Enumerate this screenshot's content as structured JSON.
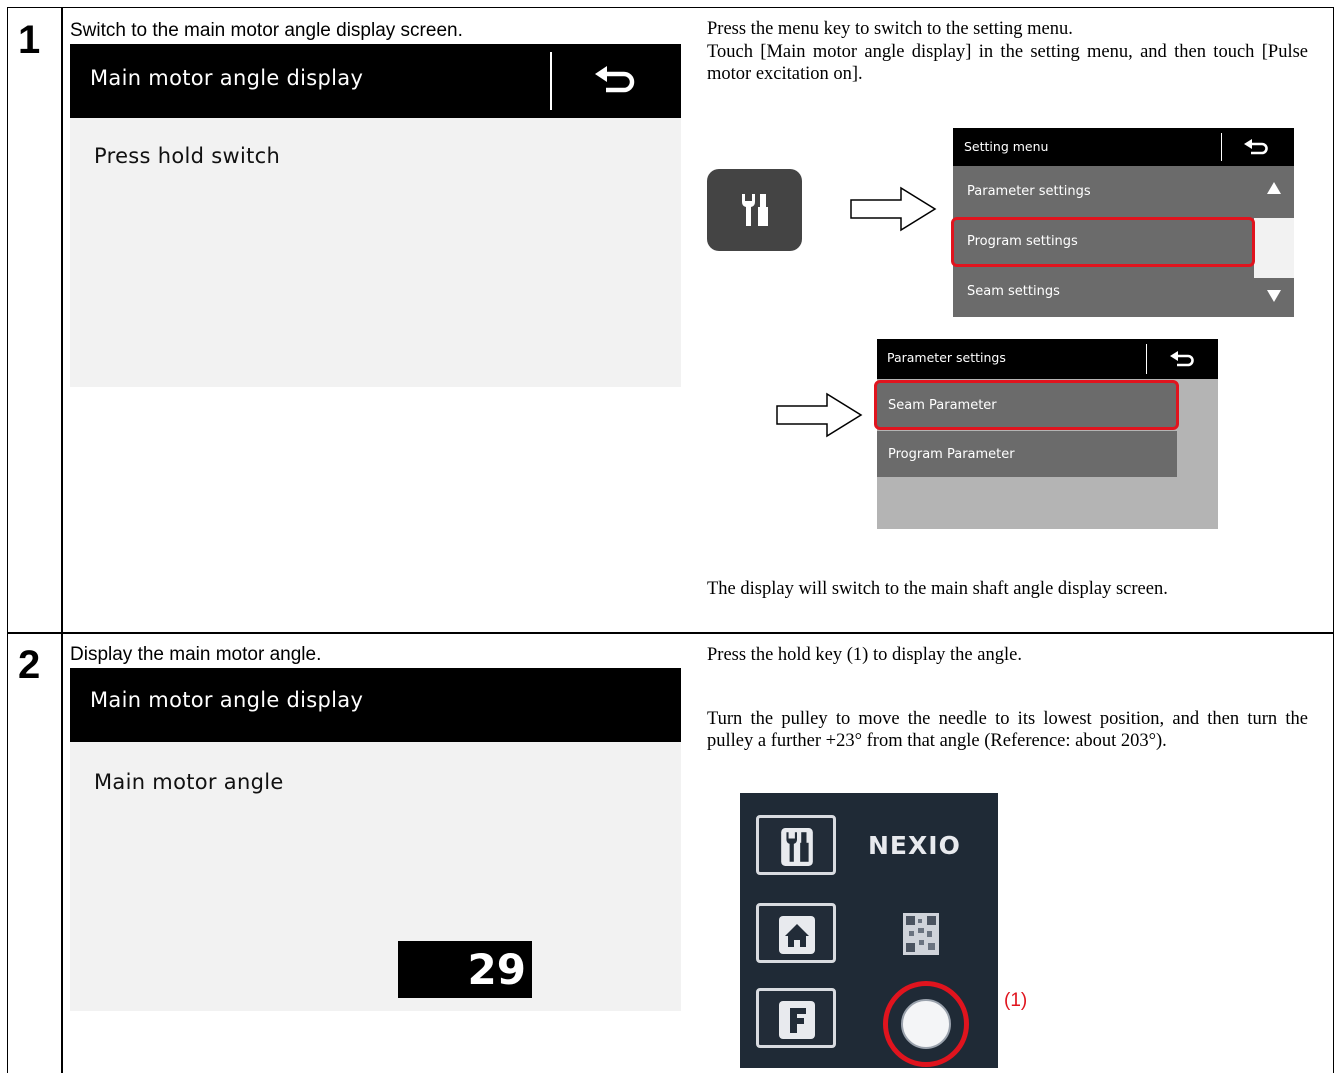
{
  "steps": [
    {
      "number": "1",
      "caption": "Switch to the main motor angle display screen.",
      "screen": {
        "title": "Main motor angle display",
        "body_text": "Press hold switch"
      },
      "instructions": {
        "line1": "Press the menu key to switch to the setting menu.",
        "line2": "Touch [Main motor angle display] in the setting menu, and then touch [Pulse motor excitation on].",
        "result": "The display will switch to the main shaft angle display screen."
      },
      "setting_menu": {
        "title": "Setting menu",
        "items": [
          "Parameter settings",
          "Program settings",
          "Seam settings"
        ],
        "highlighted": "Program settings"
      },
      "parameter_menu": {
        "title": "Parameter settings",
        "items": [
          "Seam Parameter",
          "Program Parameter"
        ],
        "highlighted": "Seam Parameter"
      }
    },
    {
      "number": "2",
      "caption": "Display the main motor angle.",
      "screen": {
        "title": "Main motor angle display",
        "label": "Main motor angle",
        "angle_value": "29"
      },
      "instructions": {
        "line1": "Press the hold key (1) to display the angle.",
        "line2": "Turn the pulley to move the needle to its lowest position, and then turn the pulley a further +23° from that angle (Reference: about 203°)."
      },
      "control_panel": {
        "brand": "NEXIO",
        "hold_key_label": "(1)",
        "buttons": [
          "menu-key",
          "home-key",
          "F"
        ]
      }
    }
  ],
  "colors": {
    "highlight": "#e0141e",
    "menu_row": "#6b6b6b",
    "panel_bg": "#f2f2f2",
    "control_panel_bg": "#1f2a36"
  }
}
